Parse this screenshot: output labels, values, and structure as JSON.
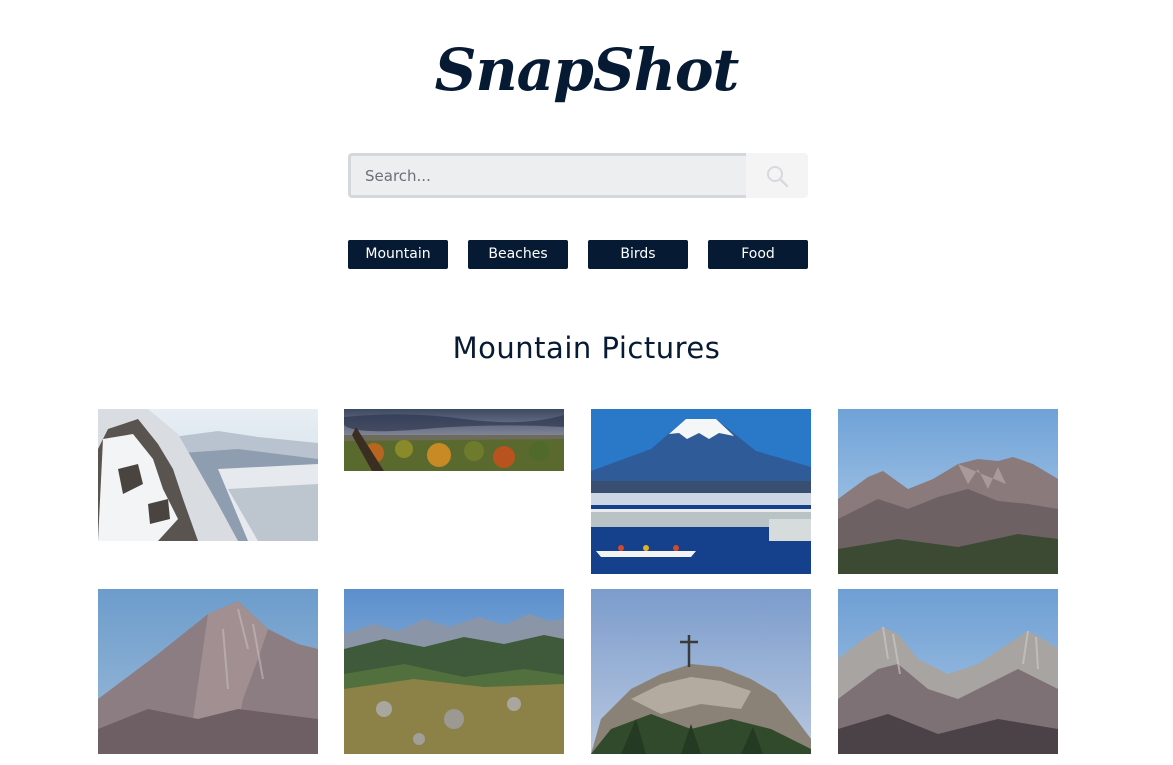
{
  "brand": {
    "logo_text": "SnapShot"
  },
  "search": {
    "placeholder": "Search...",
    "icon": "search-icon"
  },
  "categories": [
    {
      "label": "Mountain"
    },
    {
      "label": "Beaches"
    },
    {
      "label": "Birds"
    },
    {
      "label": "Food"
    }
  ],
  "gallery": {
    "title": "Mountain Pictures",
    "photos": [
      {
        "subject": "snowy-mountain-ridge"
      },
      {
        "subject": "autumn-forest-panorama"
      },
      {
        "subject": "mount-fuji-harbor-kayak"
      },
      {
        "subject": "alpine-rocky-peaks"
      },
      {
        "subject": "single-rocky-peak"
      },
      {
        "subject": "alpine-meadow-valley"
      },
      {
        "subject": "summit-cross"
      },
      {
        "subject": "twin-alpine-peaks"
      }
    ]
  },
  "colors": {
    "primary": "#071a33",
    "button_text": "#ffffff",
    "search_bg": "#edeef0",
    "search_border": "#d4d7dc"
  }
}
